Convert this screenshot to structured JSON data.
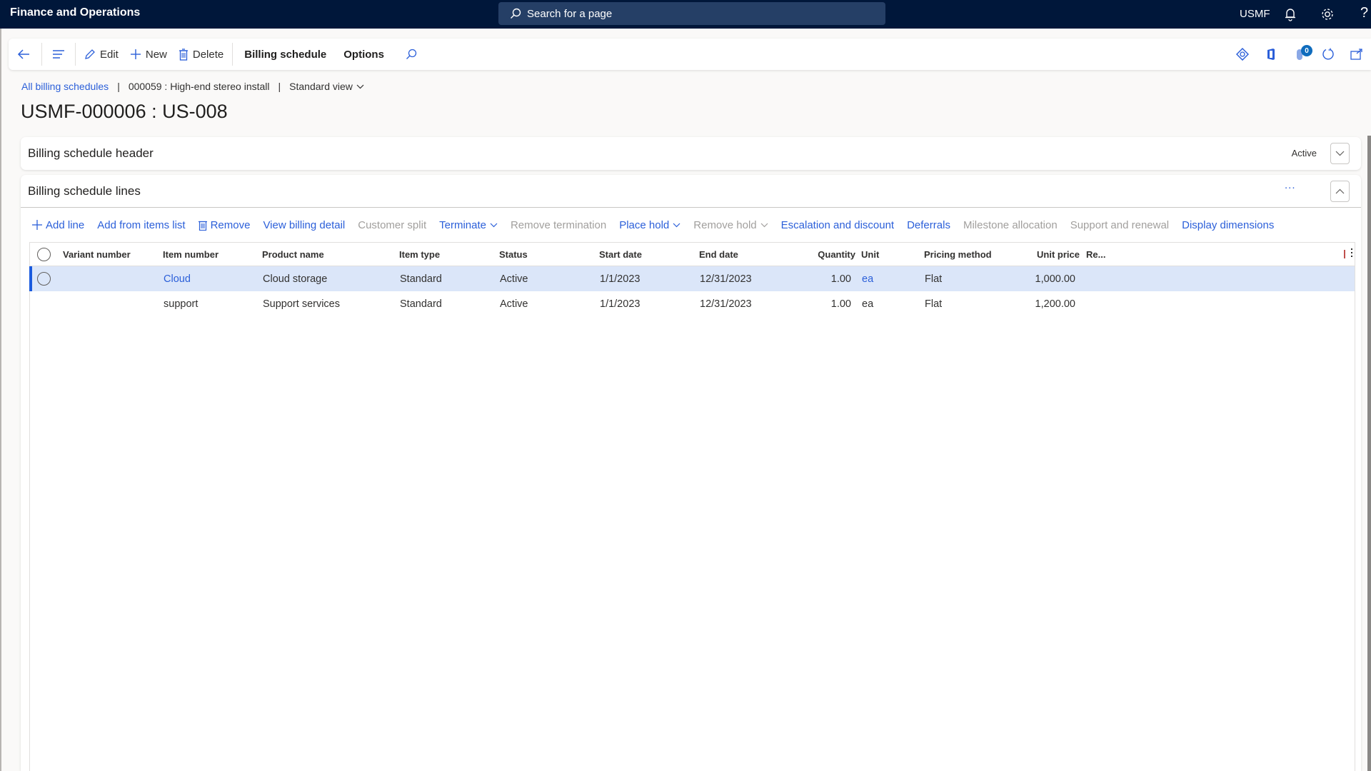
{
  "topbar": {
    "app_title": "Finance and Operations",
    "search_placeholder": "Search for a page",
    "company": "USMF",
    "icons": [
      "bell-icon",
      "gear-icon",
      "help-icon"
    ],
    "help_glyph": "?"
  },
  "action_pane": {
    "back_icon": "back-arrow-icon",
    "menu_icon": "hamburger-icon",
    "edit_label": "Edit",
    "new_label": "New",
    "delete_label": "Delete",
    "billing_schedule_label": "Billing schedule",
    "options_label": "Options",
    "right_icons": [
      "power-apps-icon",
      "office-icon",
      "attachments-icon",
      "refresh-icon",
      "open-new-window-icon"
    ],
    "attachments_count": "0"
  },
  "breadcrumb": {
    "root_link": "All billing schedules",
    "record": "000059 : High-end stereo install",
    "view": "Standard view"
  },
  "page_title": "USMF-000006 : US-008",
  "header_fasttab": {
    "title": "Billing schedule header",
    "summary": "Active",
    "expanded": false
  },
  "lines_fasttab": {
    "title": "Billing schedule lines",
    "expanded": true,
    "toolbar": [
      {
        "label": "Add line",
        "enabled": true,
        "icon": "plus"
      },
      {
        "label": "Add from items list",
        "enabled": true
      },
      {
        "label": "Remove",
        "enabled": true,
        "icon": "trash"
      },
      {
        "label": "View billing detail",
        "enabled": true
      },
      {
        "label": "Customer split",
        "enabled": false
      },
      {
        "label": "Terminate",
        "enabled": true,
        "dropdown": true
      },
      {
        "label": "Remove termination",
        "enabled": false
      },
      {
        "label": "Place hold",
        "enabled": true,
        "dropdown": true
      },
      {
        "label": "Remove hold",
        "enabled": false,
        "dropdown": true
      },
      {
        "label": "Escalation and discount",
        "enabled": true
      },
      {
        "label": "Deferrals",
        "enabled": true
      },
      {
        "label": "Milestone allocation",
        "enabled": false
      },
      {
        "label": "Support and renewal",
        "enabled": false
      },
      {
        "label": "Display dimensions",
        "enabled": true
      }
    ],
    "more_label": "...",
    "columns": [
      "Variant number",
      "Item number",
      "Product name",
      "Item type",
      "Status",
      "Start date",
      "End date",
      "Quantity",
      "Unit",
      "Pricing method",
      "Unit price",
      "Re..."
    ],
    "rows": [
      {
        "variant": "",
        "item": "Cloud",
        "product": "Cloud storage",
        "type": "Standard",
        "status": "Active",
        "start": "1/1/2023",
        "end": "12/31/2023",
        "qty": "1.00",
        "unit": "ea",
        "pricing": "Flat",
        "price": "1,000.00",
        "selected": true
      },
      {
        "variant": "",
        "item": "support",
        "product": "Support services",
        "type": "Standard",
        "status": "Active",
        "start": "1/1/2023",
        "end": "12/31/2023",
        "qty": "1.00",
        "unit": "ea",
        "pricing": "Flat",
        "price": "1,200.00",
        "selected": false
      }
    ]
  },
  "colors": {
    "topbar": "#00173a",
    "search_box": "#253f66",
    "link": "#2b5fd9",
    "selected_row": "#dbe6f9",
    "selected_marker": "#1a5bde",
    "disabled_text": "#a19f9d"
  }
}
